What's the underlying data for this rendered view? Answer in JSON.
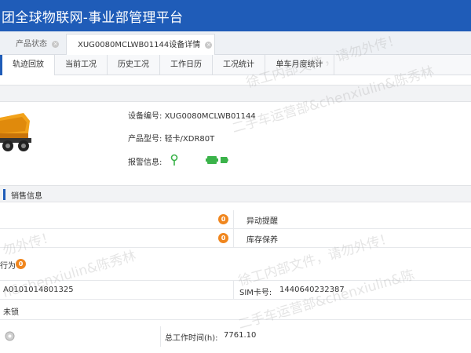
{
  "header": {
    "title": "团全球物联网-事业部管理平台"
  },
  "page_tabs": [
    {
      "label": "产品状态",
      "close": "×"
    },
    {
      "label": "XUG0080MCLWB01144设备详情",
      "close": "×"
    }
  ],
  "sub_tabs": [
    "轨迹回放",
    "当前工况",
    "历史工况",
    "工作日历",
    "工况统计",
    "单车月度统计"
  ],
  "device": {
    "serial_label": "设备编号:",
    "serial_value": "XUG0080MCLWB01144",
    "model_label": "产品型号:",
    "model_value": "轻卡/XDR80T",
    "alarm_label": "报警信息:"
  },
  "sales_section": {
    "title": "销售信息"
  },
  "rows": {
    "abnormal_count": "0",
    "abnormal_label": "异动提醒",
    "stock_count": "0",
    "stock_label": "库存保养",
    "behavior_partial": "行为",
    "behavior_count": "0",
    "terminal_partial": "A0101014801325",
    "sim_label": "SIM卡号:",
    "sim_value": "1440640232387",
    "lock_partial": "未锁",
    "total_hours_label": "总工作时间(h):",
    "total_hours_value": "7761.10"
  },
  "watermarks": [
    "徐工内部文件，请勿外传！",
    "二手车运营部&chenxiulin&陈秀林",
    "勿外传！",
    "n&chenxiulin&陈秀林",
    "徐工内部文件，请勿外传！",
    "二手车运营部&chenxiulin&陈"
  ],
  "colors": {
    "brand_blue": "#1f5cb8",
    "badge_orange": "#f0861e",
    "alarm_green": "#3bb34a"
  }
}
